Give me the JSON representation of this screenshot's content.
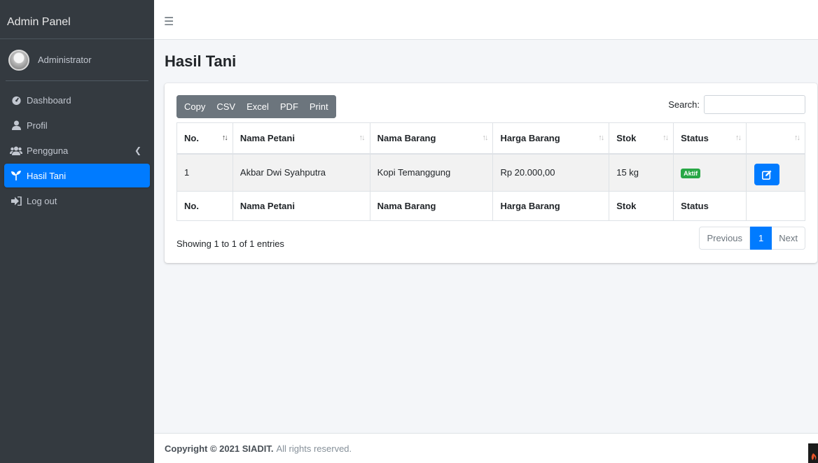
{
  "sidebar": {
    "brand": "Admin Panel",
    "user": "Administrator",
    "items": [
      {
        "label": "Dashboard",
        "icon": "tachometer-icon"
      },
      {
        "label": "Profil",
        "icon": "user-icon"
      },
      {
        "label": "Pengguna",
        "icon": "users-icon"
      },
      {
        "label": "Hasil Tani",
        "icon": "seedling-icon"
      },
      {
        "label": "Log out",
        "icon": "sign-out-icon"
      }
    ],
    "active": "Hasil Tani"
  },
  "page": {
    "title": "Hasil Tani"
  },
  "toolbar": {
    "buttons": [
      "Copy",
      "CSV",
      "Excel",
      "PDF",
      "Print"
    ],
    "search_label": "Search:",
    "search_value": ""
  },
  "table": {
    "headers": [
      "No.",
      "Nama Petani",
      "Nama Barang",
      "Harga Barang",
      "Stok",
      "Status",
      ""
    ],
    "rows": [
      {
        "no": "1",
        "nama_petani": "Akbar Dwi Syahputra",
        "nama_barang": "Kopi Temanggung",
        "harga": "Rp 20.000,00",
        "stok": "15 kg",
        "status": "Aktif"
      }
    ],
    "footer": [
      "No.",
      "Nama Petani",
      "Nama Barang",
      "Harga Barang",
      "Stok",
      "Status",
      ""
    ]
  },
  "info": "Showing 1 to 1 of 1 entries",
  "pagination": {
    "prev": "Previous",
    "current": "1",
    "next": "Next"
  },
  "footer": {
    "brand": "Copyright © 2021 SIADIT.",
    "text": "All rights reserved."
  },
  "colors": {
    "primary": "#007bff",
    "sidebar": "#343a40",
    "success": "#28a745",
    "secondary": "#6c757d"
  }
}
